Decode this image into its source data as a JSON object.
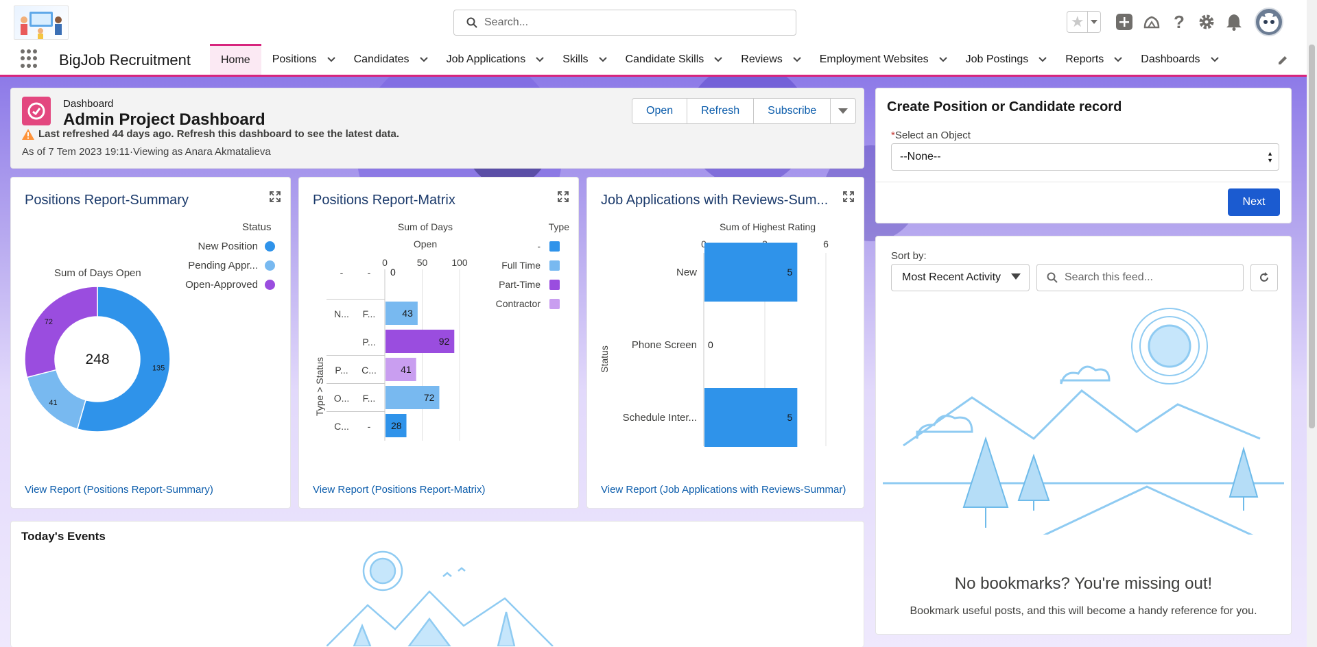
{
  "header": {
    "search_placeholder": "Search...",
    "app_name": "BigJob Recruitment"
  },
  "nav": {
    "items": [
      {
        "label": "Home",
        "has_menu": false,
        "active": true
      },
      {
        "label": "Positions",
        "has_menu": true
      },
      {
        "label": "Candidates",
        "has_menu": true
      },
      {
        "label": "Job Applications",
        "has_menu": true
      },
      {
        "label": "Skills",
        "has_menu": true
      },
      {
        "label": "Candidate Skills",
        "has_menu": true
      },
      {
        "label": "Reviews",
        "has_menu": true
      },
      {
        "label": "Employment Websites",
        "has_menu": true
      },
      {
        "label": "Job Postings",
        "has_menu": true
      },
      {
        "label": "Reports",
        "has_menu": true
      },
      {
        "label": "Dashboards",
        "has_menu": true
      }
    ]
  },
  "dashboard": {
    "type_label": "Dashboard",
    "title": "Admin Project Dashboard",
    "warning": "Last refreshed 44 days ago. Refresh this dashboard to see the latest data.",
    "as_of": "As of 7 Tem 2023 19:11·Viewing as Anara Akmatalieva",
    "buttons": {
      "open": "Open",
      "refresh": "Refresh",
      "subscribe": "Subscribe"
    }
  },
  "reports": [
    {
      "title": "Positions Report-Summary",
      "link": "View Report (Positions Report-Summary)"
    },
    {
      "title": "Positions Report-Matrix",
      "link": "View Report (Positions Report-Matrix)"
    },
    {
      "title": "Job Applications with Reviews-Sum...",
      "link": "View Report (Job Applications with Reviews-Summar)"
    }
  ],
  "chart_data": [
    {
      "type": "pie",
      "variant": "donut",
      "title": "Sum of Days Open",
      "legend_title": "Status",
      "center_total": "248",
      "categories": [
        "New Position",
        "Pending Appr...",
        "Open-Approved"
      ],
      "values": [
        135,
        41,
        72
      ],
      "colors": [
        "#2f93ea",
        "#78b9f0",
        "#9a4ddf"
      ]
    },
    {
      "type": "bar",
      "orientation": "horizontal",
      "stacked_labels": true,
      "x_title_line1": "Sum of Days",
      "x_title_line2": "Open",
      "ylabel": "Type > Status",
      "xticks": [
        "0",
        "50",
        "100"
      ],
      "xlim": [
        0,
        100
      ],
      "legend_title": "Type",
      "legend": [
        {
          "name": "-",
          "color": "#2f93ea"
        },
        {
          "name": "Full Time",
          "color": "#78b9f0"
        },
        {
          "name": "Part-Time",
          "color": "#9a4ddf"
        },
        {
          "name": "Contractor",
          "color": "#c99ef0"
        }
      ],
      "rows": [
        {
          "group": "-",
          "sub": "-",
          "value": 0,
          "label": "0",
          "color": "#2f93ea"
        },
        {
          "group": "N...",
          "sub": "F...",
          "value": 43,
          "label": "43",
          "color": "#78b9f0"
        },
        {
          "group": "",
          "sub": "P...",
          "value": 92,
          "label": "92",
          "color": "#9a4ddf"
        },
        {
          "group": "P...",
          "sub": "C...",
          "value": 41,
          "label": "41",
          "color": "#c99ef0"
        },
        {
          "group": "O...",
          "sub": "F...",
          "value": 72,
          "label": "72",
          "color": "#78b9f0"
        },
        {
          "group": "C...",
          "sub": "-",
          "value": 28,
          "label": "28",
          "color": "#2f93ea"
        }
      ]
    },
    {
      "type": "bar",
      "orientation": "horizontal",
      "xlabel": "Sum of Highest Rating",
      "ylabel": "Status",
      "xticks": [
        "0",
        "3",
        "6"
      ],
      "xlim": [
        0,
        6
      ],
      "categories": [
        "New",
        "Phone Screen",
        "Schedule Inter..."
      ],
      "values": [
        5,
        0,
        5
      ],
      "labels": [
        "5",
        "0",
        "5"
      ],
      "color": "#2f93ea"
    }
  ],
  "create_record": {
    "title": "Create Position or Candidate record",
    "required_mark": "*",
    "field_label": "Select an Object",
    "selected": "--None--",
    "next": "Next"
  },
  "feed": {
    "sort_label": "Sort by:",
    "sort_value": "Most Recent Activity",
    "search_placeholder": "Search this feed...",
    "empty_title": "No bookmarks? You're missing out!",
    "empty_sub": "Bookmark useful posts, and this will become a handy reference for you."
  },
  "events": {
    "title": "Today's Events"
  }
}
